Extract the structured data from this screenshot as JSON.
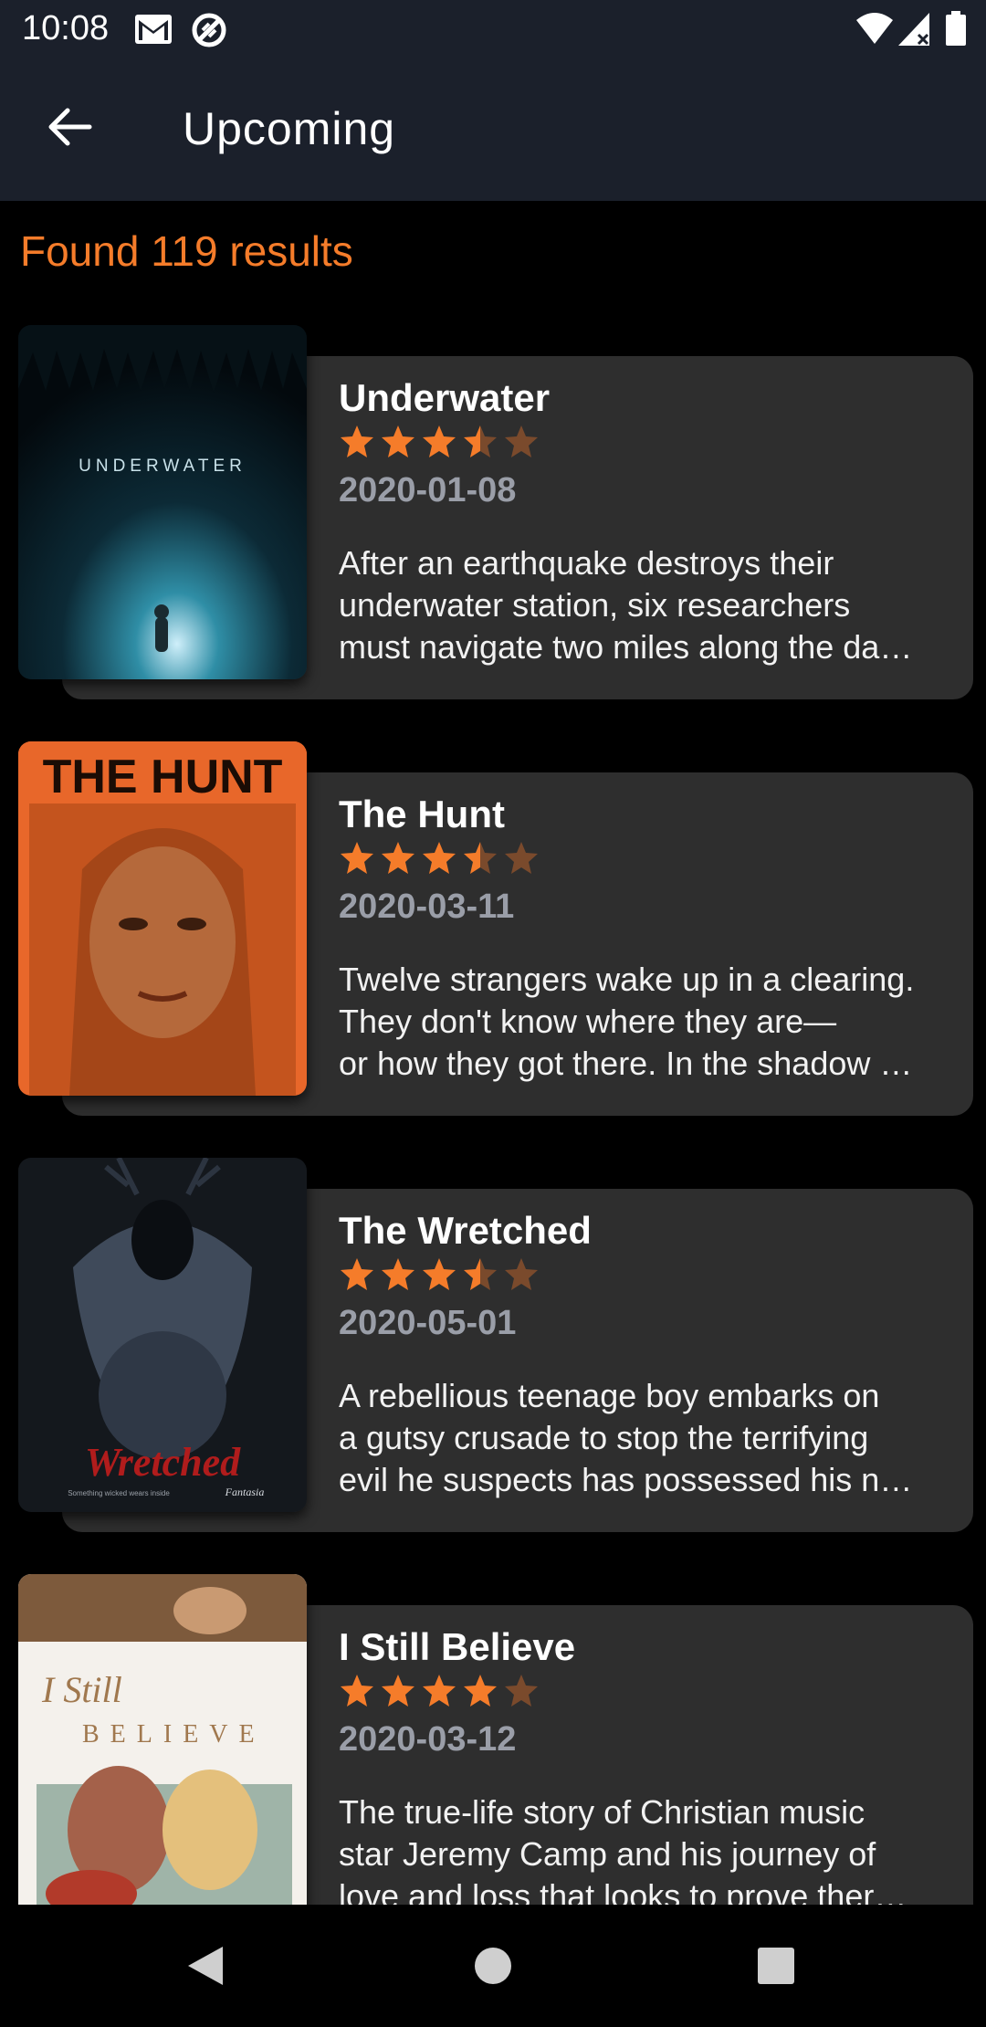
{
  "status": {
    "time": "10:08"
  },
  "header": {
    "title": "Upcoming"
  },
  "results_text": "Found 119 results",
  "colors": {
    "accent": "#f57c2a",
    "card": "#2e2e2e",
    "appbar": "#1b202b"
  },
  "movies": [
    {
      "title": "Underwater",
      "rating_stars": 3.5,
      "date": "2020-01-08",
      "description": "After an earthquake destroys their\nunderwater station, six researchers\nmust navigate two miles along the da…",
      "poster_text": "UNDERWATER"
    },
    {
      "title": "The Hunt",
      "rating_stars": 3.5,
      "date": "2020-03-11",
      "description": "Twelve strangers wake up in a clearing.\nThey don't know where they are—\nor how they got there. In the shadow …",
      "poster_text": "THE HUNT"
    },
    {
      "title": "The Wretched",
      "rating_stars": 3.5,
      "date": "2020-05-01",
      "description": "A rebellious teenage boy embarks on\na gutsy crusade to stop the terrifying\nevil he suspects has possessed his n…",
      "poster_text": "Wretched",
      "poster_tagline": "Something wicked wears inside",
      "poster_badge": "Fantasia"
    },
    {
      "title": "I Still Believe",
      "rating_stars": 4,
      "date": "2020-03-12",
      "description": "The true-life story of Christian music\nstar Jeremy Camp and his journey of\nlove and loss that looks to prove ther…",
      "poster_text_1": "I Still",
      "poster_text_2": "BELIEVE"
    }
  ],
  "icons": {
    "back": "arrow-left-icon",
    "nav_back": "triangle-back-icon",
    "nav_home": "circle-home-icon",
    "nav_recents": "square-recents-icon"
  }
}
